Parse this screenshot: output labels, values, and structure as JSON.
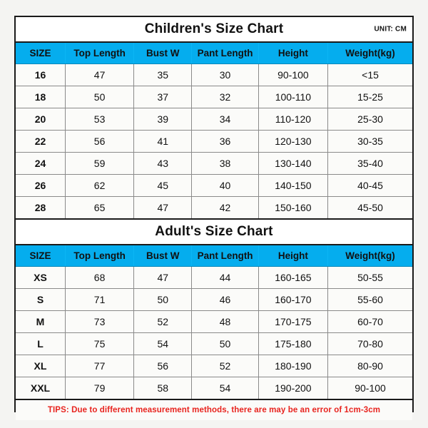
{
  "page": {
    "background_color": "#f4f4f2",
    "accent_color": "#05adee",
    "tips_color": "#e8241f",
    "border_color": "#1a1a1a"
  },
  "columns": [
    "SIZE",
    "Top Length",
    "Bust W",
    "Pant Length",
    "Height",
    "Weight(kg)"
  ],
  "children_section": {
    "title": "Children's Size Chart",
    "unit_label": "UNIT: CM",
    "rows": [
      [
        "16",
        "47",
        "35",
        "30",
        "90-100",
        "<15"
      ],
      [
        "18",
        "50",
        "37",
        "32",
        "100-110",
        "15-25"
      ],
      [
        "20",
        "53",
        "39",
        "34",
        "110-120",
        "25-30"
      ],
      [
        "22",
        "56",
        "41",
        "36",
        "120-130",
        "30-35"
      ],
      [
        "24",
        "59",
        "43",
        "38",
        "130-140",
        "35-40"
      ],
      [
        "26",
        "62",
        "45",
        "40",
        "140-150",
        "40-45"
      ],
      [
        "28",
        "65",
        "47",
        "42",
        "150-160",
        "45-50"
      ]
    ]
  },
  "adult_section": {
    "title": "Adult's Size Chart",
    "rows": [
      [
        "XS",
        "68",
        "47",
        "44",
        "160-165",
        "50-55"
      ],
      [
        "S",
        "71",
        "50",
        "46",
        "160-170",
        "55-60"
      ],
      [
        "M",
        "73",
        "52",
        "48",
        "170-175",
        "60-70"
      ],
      [
        "L",
        "75",
        "54",
        "50",
        "175-180",
        "70-80"
      ],
      [
        "XL",
        "77",
        "56",
        "52",
        "180-190",
        "80-90"
      ],
      [
        "XXL",
        "79",
        "58",
        "54",
        "190-200",
        "90-100"
      ]
    ]
  },
  "footer": {
    "tips": "TIPS: Due to different measurement methods, there are may be an error of 1cm-3cm"
  }
}
